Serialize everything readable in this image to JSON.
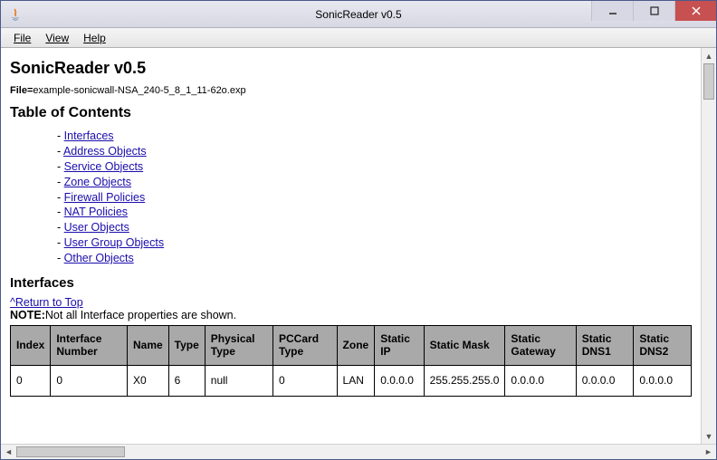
{
  "window": {
    "title": "SonicReader v0.5"
  },
  "menu": {
    "file": "File",
    "view": "View",
    "help": "Help"
  },
  "page": {
    "heading": "SonicReader v0.5",
    "file_label": "File=",
    "file_value": "example-sonicwall-NSA_240-5_8_1_11-62o.exp",
    "toc_heading": "Table of Contents",
    "toc": [
      "Interfaces",
      "Address Objects",
      "Service Objects",
      "Zone Objects",
      "Firewall Policies",
      "NAT Policies",
      "User Objects",
      "User Group Objects",
      "Other Objects"
    ],
    "section_heading": "Interfaces",
    "return_link": "^Return to Top",
    "note_label": "NOTE:",
    "note_text": "Not all Interface properties are shown."
  },
  "table": {
    "headers": [
      "Index",
      "Interface Number",
      "Name",
      "Type",
      "Physical Type",
      "PCCard Type",
      "Zone",
      "Static IP",
      "Static Mask",
      "Static Gateway",
      "Static DNS1",
      "Static DNS2"
    ],
    "rows": [
      [
        "0",
        "0",
        "X0",
        "6",
        "null",
        "0",
        "LAN",
        "0.0.0.0",
        "255.255.255.0",
        "0.0.0.0",
        "0.0.0.0",
        "0.0.0.0"
      ]
    ]
  }
}
